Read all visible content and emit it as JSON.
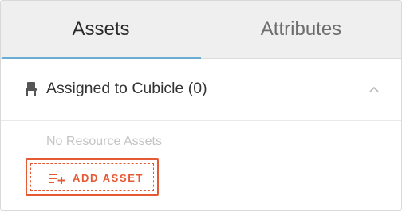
{
  "tabs": [
    {
      "label": "Assets",
      "active": true
    },
    {
      "label": "Attributes",
      "active": false
    }
  ],
  "section": {
    "icon": "chair-icon",
    "title": "Assigned to Cubicle (0)",
    "toggle_icon": "chevron-up-icon"
  },
  "empty_state": "No Resource Assets",
  "add_button": {
    "icon": "playlist-add-icon",
    "label": "ADD ASSET"
  },
  "colors": {
    "accent": "#e45a35",
    "tab_indicator": "#6aaed3",
    "tab_bar_bg": "#efefef"
  }
}
